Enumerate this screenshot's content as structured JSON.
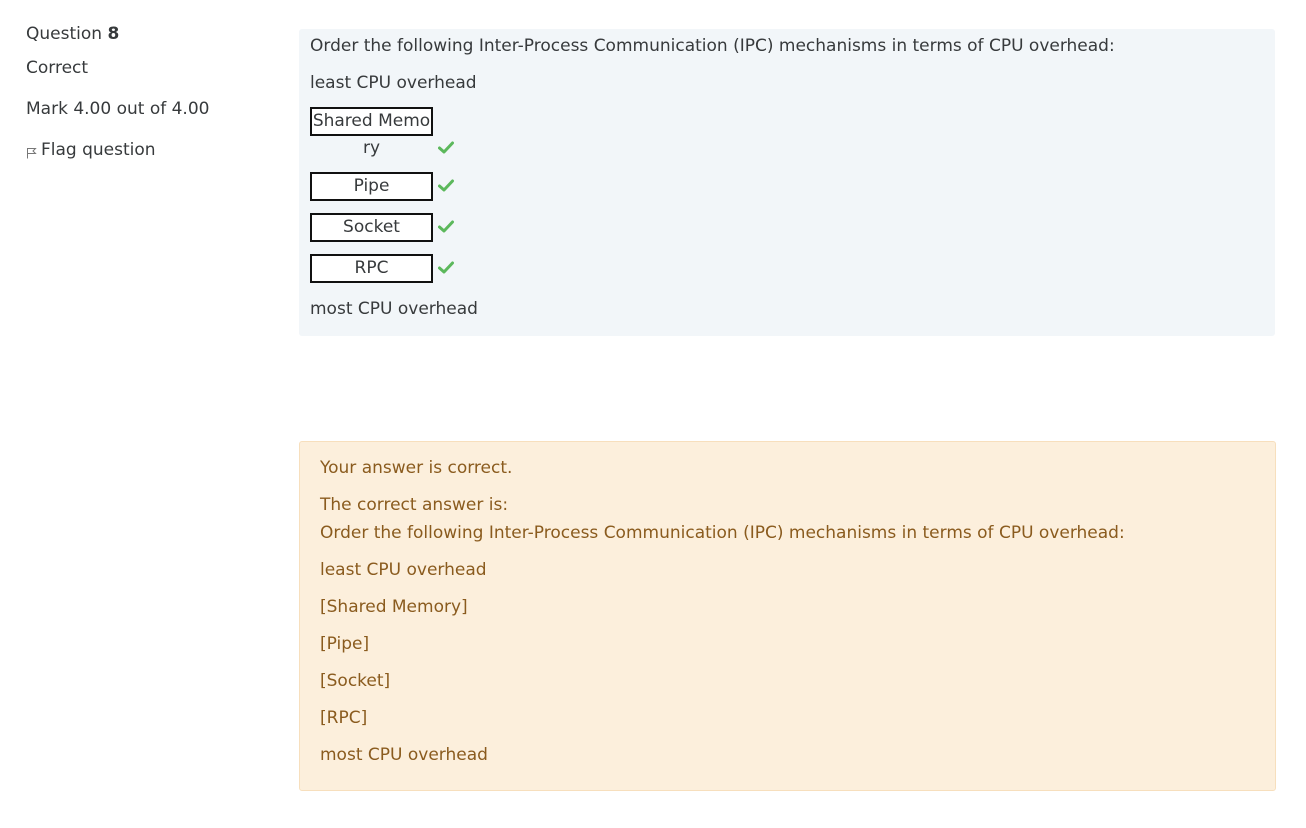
{
  "info": {
    "question_label": "Question",
    "question_number": "8",
    "state": "Correct",
    "grade": "Mark 4.00 out of 4.00",
    "flag_label": "Flag question",
    "flag_icon": "flag-icon"
  },
  "question": {
    "text": "Order the following Inter-Process Communication (IPC) mechanisms in terms of CPU overhead:",
    "prompt_top": "least CPU overhead",
    "prompt_bottom": "most CPU overhead",
    "answers": [
      {
        "label_visible": "Shared Memo",
        "label_overflow": "ry",
        "correct": true
      },
      {
        "label_visible": "Pipe",
        "correct": true
      },
      {
        "label_visible": "Socket",
        "correct": true
      },
      {
        "label_visible": "RPC",
        "correct": true
      }
    ],
    "check_color": "#5cb85c"
  },
  "feedback": {
    "result": "Your answer is correct.",
    "correct_intro": "The correct answer is:",
    "question_text": "Order the following Inter-Process Communication (IPC) mechanisms in terms of CPU overhead:",
    "top": "least CPU overhead",
    "items": [
      "[Shared Memory]",
      "[Pipe]",
      "[Socket]",
      "[RPC]"
    ],
    "bottom": "most CPU overhead"
  },
  "colors": {
    "formulation_bg": "#f2f6f9",
    "outcome_bg": "#fcefdc",
    "outcome_text": "#8a5b1e"
  }
}
